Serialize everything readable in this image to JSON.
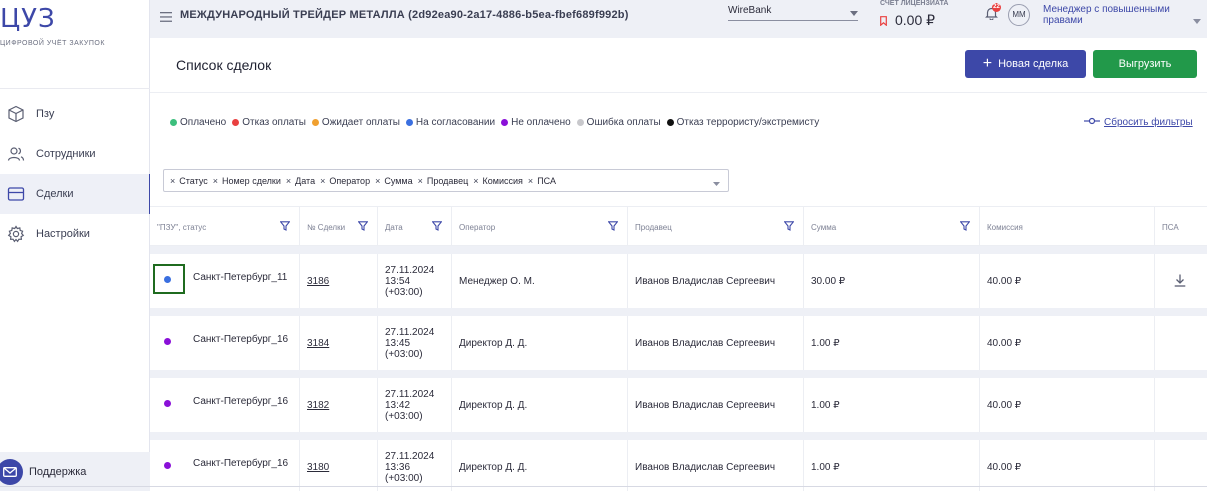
{
  "sidebar": {
    "logo": "ЦУЗ",
    "logo_sub": "ЦИФРОВОЙ УЧЁТ ЗАКУПОК",
    "items": [
      {
        "label": "Пзу",
        "icon": "cube-icon"
      },
      {
        "label": "Сотрудники",
        "icon": "users-icon"
      },
      {
        "label": "Сделки",
        "icon": "deals-icon",
        "active": true
      },
      {
        "label": "Настройки",
        "icon": "gear-icon"
      }
    ],
    "support": "Поддержка"
  },
  "header": {
    "company": "МЕЖДУНАРОДНЫЙ ТРЕЙДЕР МЕТАЛЛА (2d92ea90-2a17-4886-b5ea-fbef689f992b)",
    "bank": "WireBank",
    "license_label": "СЧЕТ ЛИЦЕНЗИАТА",
    "license_value": "0.00 ₽",
    "notifications": "22",
    "avatar": "ММ",
    "role": "Менеджер с повышенными правами"
  },
  "main": {
    "title": "Список сделок",
    "new_button": "Новая сделка",
    "export_button": "Выгрузить",
    "reset_filters": "Сбросить фильтры",
    "legend": [
      {
        "label": "Оплачено",
        "color": "#3cbf7d"
      },
      {
        "label": "Отказ оплаты",
        "color": "#e94040"
      },
      {
        "label": "Ожидает оплаты",
        "color": "#f0a030"
      },
      {
        "label": "На согласовании",
        "color": "#3a6fe0"
      },
      {
        "label": "Не оплачено",
        "color": "#8a10d8"
      },
      {
        "label": "Ошибка оплаты",
        "color": "#c8c8cc"
      },
      {
        "label": "Отказ террористу/экстремисту",
        "color": "#111111"
      }
    ],
    "filter_chips": [
      "Статус",
      "Номер сделки",
      "Дата",
      "Оператор",
      "Сумма",
      "Продавец",
      "Комиссия",
      "ПСА"
    ]
  },
  "table": {
    "columns": [
      {
        "label": "\"ПЗУ\", статус",
        "filter": true
      },
      {
        "label": "№ Сделки",
        "filter": true
      },
      {
        "label": "Дата",
        "filter": true
      },
      {
        "label": "Оператор",
        "filter": true
      },
      {
        "label": "Продавец",
        "filter": true
      },
      {
        "label": "Сумма",
        "filter": true
      },
      {
        "label": "Комиссия",
        "filter": false
      },
      {
        "label": "ПСА",
        "filter": false
      }
    ],
    "rows": [
      {
        "status_color": "#3a6fe0",
        "city": "Санкт-Петербург_11",
        "deal": "3186",
        "date": "27.11.2024",
        "time": "13:54",
        "tz": "(+03:00)",
        "operator": "Менеджер О. М.",
        "seller": "Иванов Владислав Сергеевич",
        "sum": "30.00 ₽",
        "commission": "40.00 ₽",
        "download": true,
        "focused": true
      },
      {
        "status_color": "#8a10d8",
        "city": "Санкт-Петербург_16",
        "deal": "3184",
        "date": "27.11.2024",
        "time": "13:45",
        "tz": "(+03:00)",
        "operator": "Директор Д. Д.",
        "seller": "Иванов Владислав Сергеевич",
        "sum": "1.00 ₽",
        "commission": "40.00 ₽",
        "download": false,
        "focused": false
      },
      {
        "status_color": "#8a10d8",
        "city": "Санкт-Петербург_16",
        "deal": "3182",
        "date": "27.11.2024",
        "time": "13:42",
        "tz": "(+03:00)",
        "operator": "Директор Д. Д.",
        "seller": "Иванов Владислав Сергеевич",
        "sum": "1.00 ₽",
        "commission": "40.00 ₽",
        "download": false,
        "focused": false
      },
      {
        "status_color": "#8a10d8",
        "city": "Санкт-Петербург_16",
        "deal": "3180",
        "date": "27.11.2024",
        "time": "13:36",
        "tz": "(+03:00)",
        "operator": "Директор Д. Д.",
        "seller": "Иванов Владислав Сергеевич",
        "sum": "1.00 ₽",
        "commission": "40.00 ₽",
        "download": false,
        "focused": false
      }
    ]
  }
}
